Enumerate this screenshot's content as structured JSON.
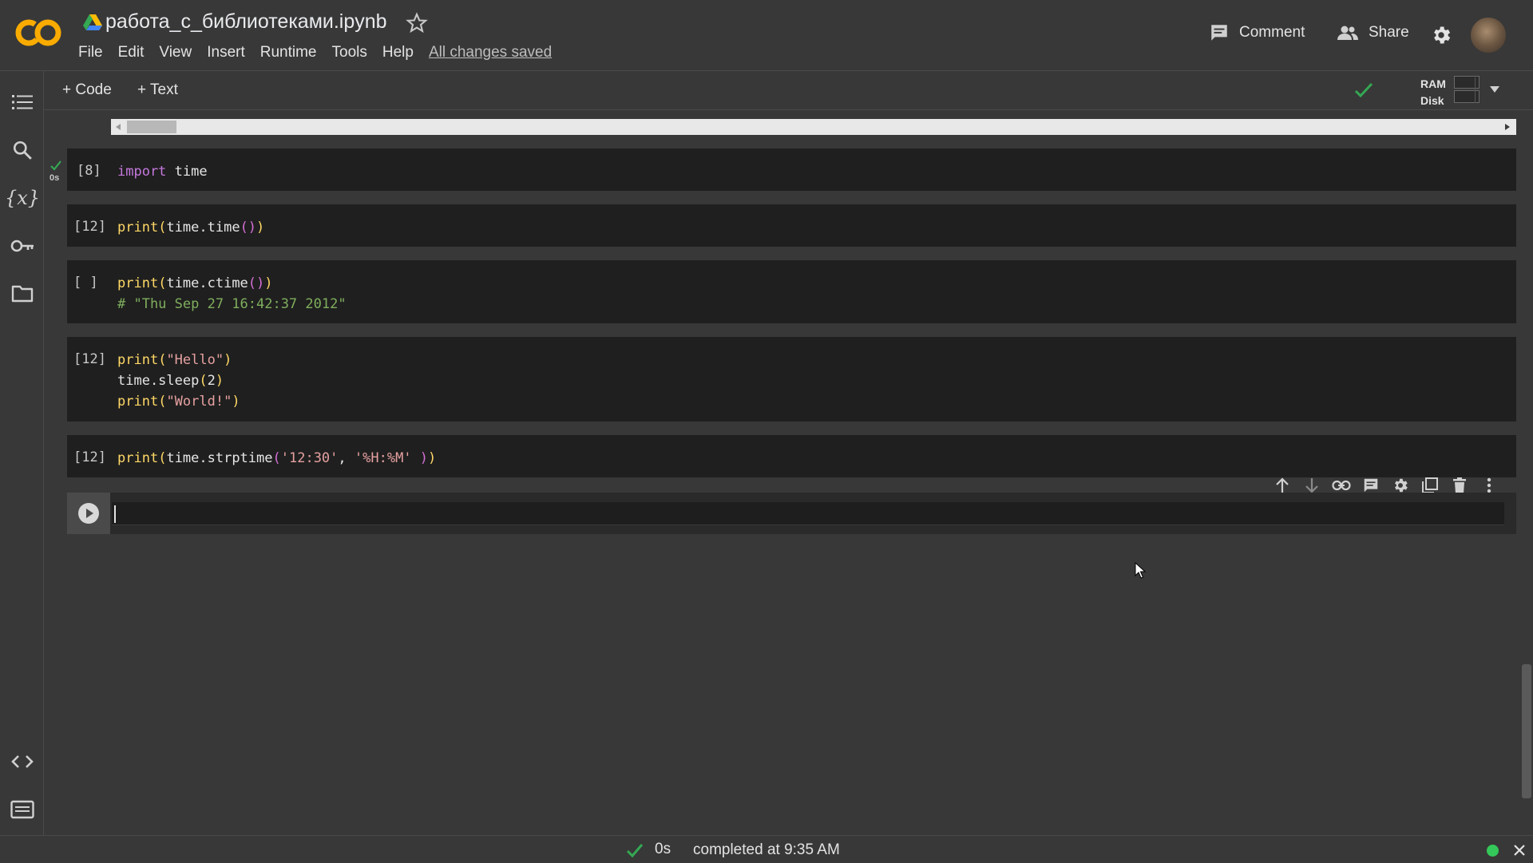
{
  "header": {
    "title": "работа_с_библиотеками.ipynb",
    "menu": [
      "File",
      "Edit",
      "View",
      "Insert",
      "Runtime",
      "Tools",
      "Help"
    ],
    "saved_status": "All changes saved",
    "comment_label": "Comment",
    "share_label": "Share"
  },
  "sidebar": {
    "icons": [
      "table-of-contents-icon",
      "search-icon",
      "variables-icon",
      "secrets-key-icon",
      "files-folder-icon",
      "code-snippets-icon",
      "command-palette-icon"
    ]
  },
  "toolbar": {
    "add_code": "+ Code",
    "add_text": "+ Text",
    "ram_label": "RAM",
    "disk_label": "Disk"
  },
  "cells": [
    {
      "count": "[8]",
      "exec_time": "0s",
      "lines": [
        "import time"
      ]
    },
    {
      "count": "[12]",
      "lines": [
        "print(time.time())"
      ]
    },
    {
      "count": "[ ]",
      "lines": [
        "print(time.ctime())",
        "# \"Thu Sep 27 16:42:37 2012\""
      ]
    },
    {
      "count": "[12]",
      "lines": [
        "print(\"Hello\")",
        "time.sleep(2)",
        "print(\"World!\")"
      ]
    },
    {
      "count": "[12]",
      "lines": [
        "print(time.strptime('12:30', '%H:%M' ))"
      ]
    }
  ],
  "status": {
    "elapsed": "0s",
    "message": "completed at 9:35 AM"
  },
  "colors": {
    "background": "#383838",
    "cell_bg": "#1f1f1f",
    "accent_orange": "#f9ab00",
    "success_green": "#34a853"
  }
}
